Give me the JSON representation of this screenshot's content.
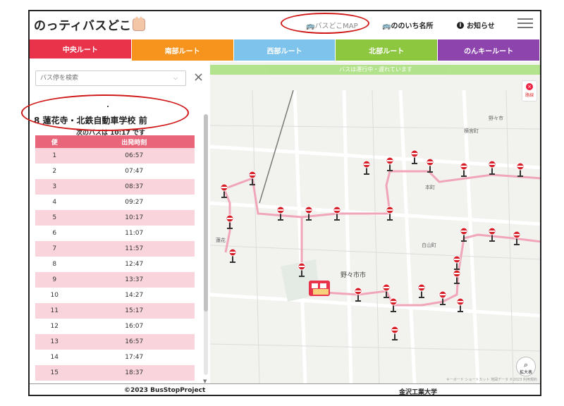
{
  "header": {
    "logo": "のっティバスどこ",
    "links": {
      "map": "🚌バスどこMAP",
      "names": "🚌ののいち名所",
      "news": "お知らせ"
    }
  },
  "tabs": [
    {
      "label": "中央ルート",
      "color": "#e8334a",
      "active": true
    },
    {
      "label": "南部ルート",
      "color": "#f7941d",
      "active": false
    },
    {
      "label": "西部ルート",
      "color": "#7dc3ec",
      "active": false
    },
    {
      "label": "北部ルート",
      "color": "#8dc63f",
      "active": false
    },
    {
      "label": "のんキールート",
      "color": "#8e44ad",
      "active": false
    }
  ],
  "panel": {
    "search_placeholder": "バス停を検索",
    "stop_name": "8 蓮花寺・北鉄自動車学校 前",
    "next_bus": "次のバスは 10:17 です",
    "table_headers": [
      "便",
      "出発時刻"
    ],
    "rows": [
      [
        "1",
        "06:57"
      ],
      [
        "2",
        "07:47"
      ],
      [
        "3",
        "08:37"
      ],
      [
        "4",
        "09:27"
      ],
      [
        "5",
        "10:17"
      ],
      [
        "6",
        "11:07"
      ],
      [
        "7",
        "11:57"
      ],
      [
        "8",
        "12:47"
      ],
      [
        "9",
        "13:37"
      ],
      [
        "10",
        "14:27"
      ],
      [
        "11",
        "15:17"
      ],
      [
        "12",
        "16:07"
      ],
      [
        "13",
        "16:57"
      ],
      [
        "14",
        "17:47"
      ],
      [
        "15",
        "18:37"
      ]
    ]
  },
  "map": {
    "banner": "バスは運行中・遅れています",
    "side_button": "路線",
    "zoom_button": "拡大表",
    "labels": [
      "野々市市",
      "本町",
      "白山町",
      "横宮町",
      "野々市",
      "蓮花"
    ],
    "attribution": "キーボード ショートカット 地図データ ©2023 利用規約"
  },
  "footer": {
    "copyright": "©2023 BusStopProject",
    "university": "金沢工業大学"
  },
  "colors": {
    "route": "#f0a6b8",
    "table_header": "#e9667a",
    "table_odd": "#f9d4dc",
    "highlight": "#d01818"
  }
}
